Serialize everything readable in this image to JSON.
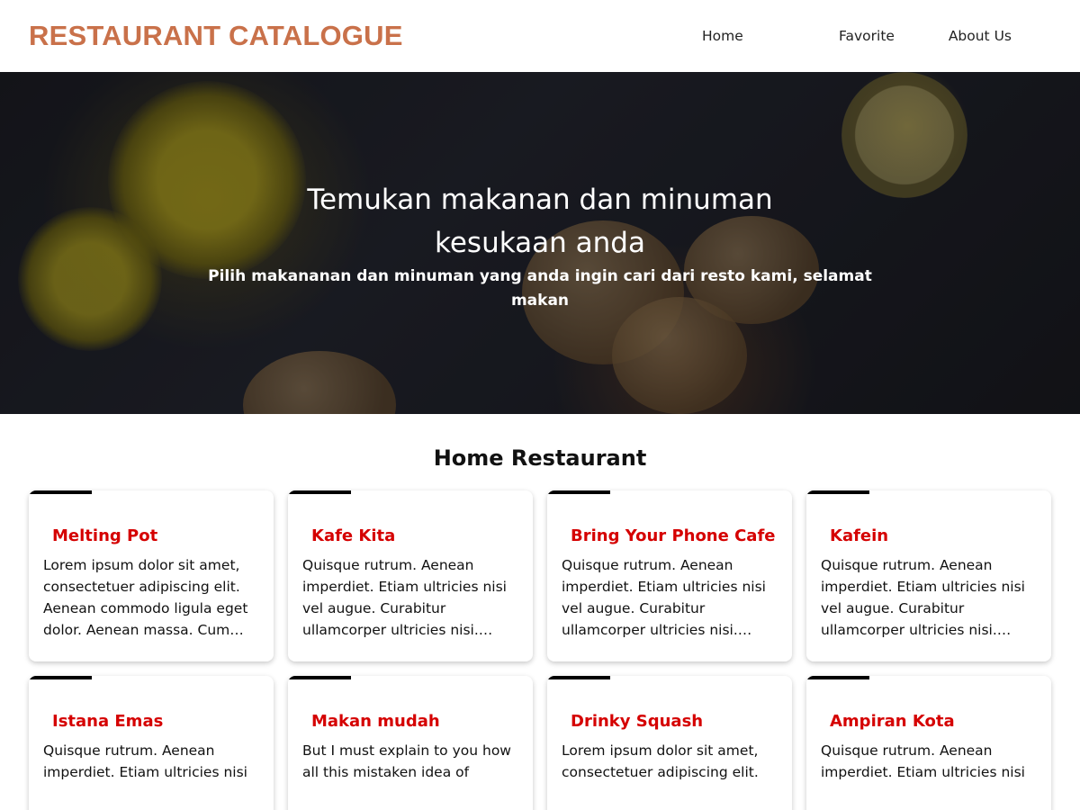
{
  "header": {
    "brand": "RESTAURANT CATALOGUE",
    "nav": [
      "Home",
      "Favorite",
      "About Us"
    ]
  },
  "hero": {
    "title": "Temukan makanan dan minuman kesukaan anda",
    "subtitle": "Pilih makananan dan minuman yang anda ingin cari dari resto kami, selamat makan"
  },
  "section_title": "Home Restaurant",
  "restaurants": [
    {
      "name": "Melting Pot",
      "desc": "Lorem ipsum dolor sit amet, consectetuer adipiscing elit. Aenean commodo ligula eget dolor. Aenean massa. Cum…"
    },
    {
      "name": "Kafe Kita",
      "desc": "Quisque rutrum. Aenean imperdiet. Etiam ultricies nisi vel augue. Curabitur ullamcorper ultricies nisi.…"
    },
    {
      "name": "Bring Your Phone Cafe",
      "desc": "Quisque rutrum. Aenean imperdiet. Etiam ultricies nisi vel augue. Curabitur ullamcorper ultricies nisi.…"
    },
    {
      "name": "Kafein",
      "desc": "Quisque rutrum. Aenean imperdiet. Etiam ultricies nisi vel augue. Curabitur ullamcorper ultricies nisi.…"
    },
    {
      "name": "Istana Emas",
      "desc": "Quisque rutrum. Aenean imperdiet. Etiam ultricies nisi"
    },
    {
      "name": "Makan mudah",
      "desc": "But I must explain to you how all this mistaken idea of"
    },
    {
      "name": "Drinky Squash",
      "desc": "Lorem ipsum dolor sit amet, consectetuer adipiscing elit."
    },
    {
      "name": "Ampiran Kota",
      "desc": "Quisque rutrum. Aenean imperdiet. Etiam ultricies nisi"
    }
  ],
  "colors": {
    "brand": "#c9714a",
    "card_title": "#d50000",
    "accent": "#000000"
  }
}
